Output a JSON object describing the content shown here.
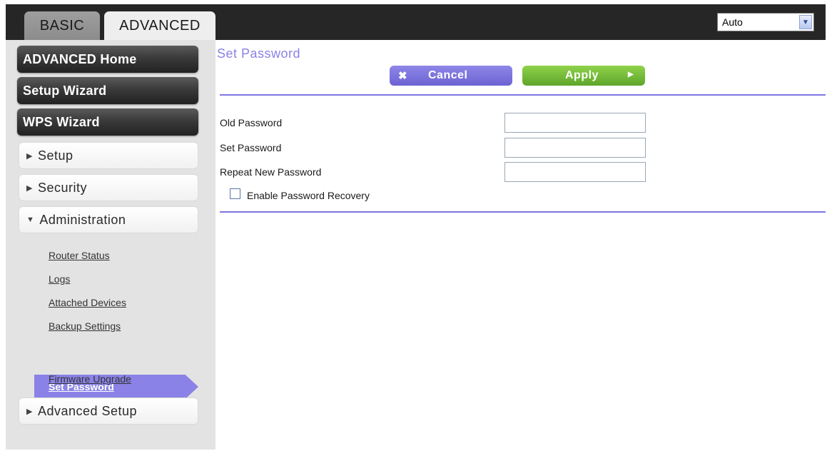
{
  "tabs": {
    "basic": "BASIC",
    "advanced": "ADVANCED"
  },
  "language": {
    "selected": "Auto"
  },
  "sidebar": {
    "advanced_home": "ADVANCED Home",
    "setup_wizard": "Setup Wizard",
    "wps_wizard": "WPS Wizard",
    "setup": "Setup",
    "security": "Security",
    "administration": "Administration",
    "admin_items": {
      "router_status": "Router Status",
      "logs": "Logs",
      "attached_devices": "Attached Devices",
      "backup_settings": "Backup Settings",
      "set_password": "Set Password",
      "firmware_upgrade": "Firmware Upgrade"
    },
    "advanced_setup": "Advanced Setup"
  },
  "main": {
    "title": "Set Password",
    "cancel_label": "Cancel",
    "apply_label": "Apply",
    "fields": {
      "old_password": "Old Password",
      "set_password": "Set Password",
      "repeat_password": "Repeat New Password"
    },
    "recovery_label": "Enable Password Recovery"
  },
  "colors": {
    "accent_purple": "#8a82e6",
    "apply_green": "#6cb832",
    "top_bar": "#262626",
    "sidebar_bg": "#e3e3e3"
  }
}
